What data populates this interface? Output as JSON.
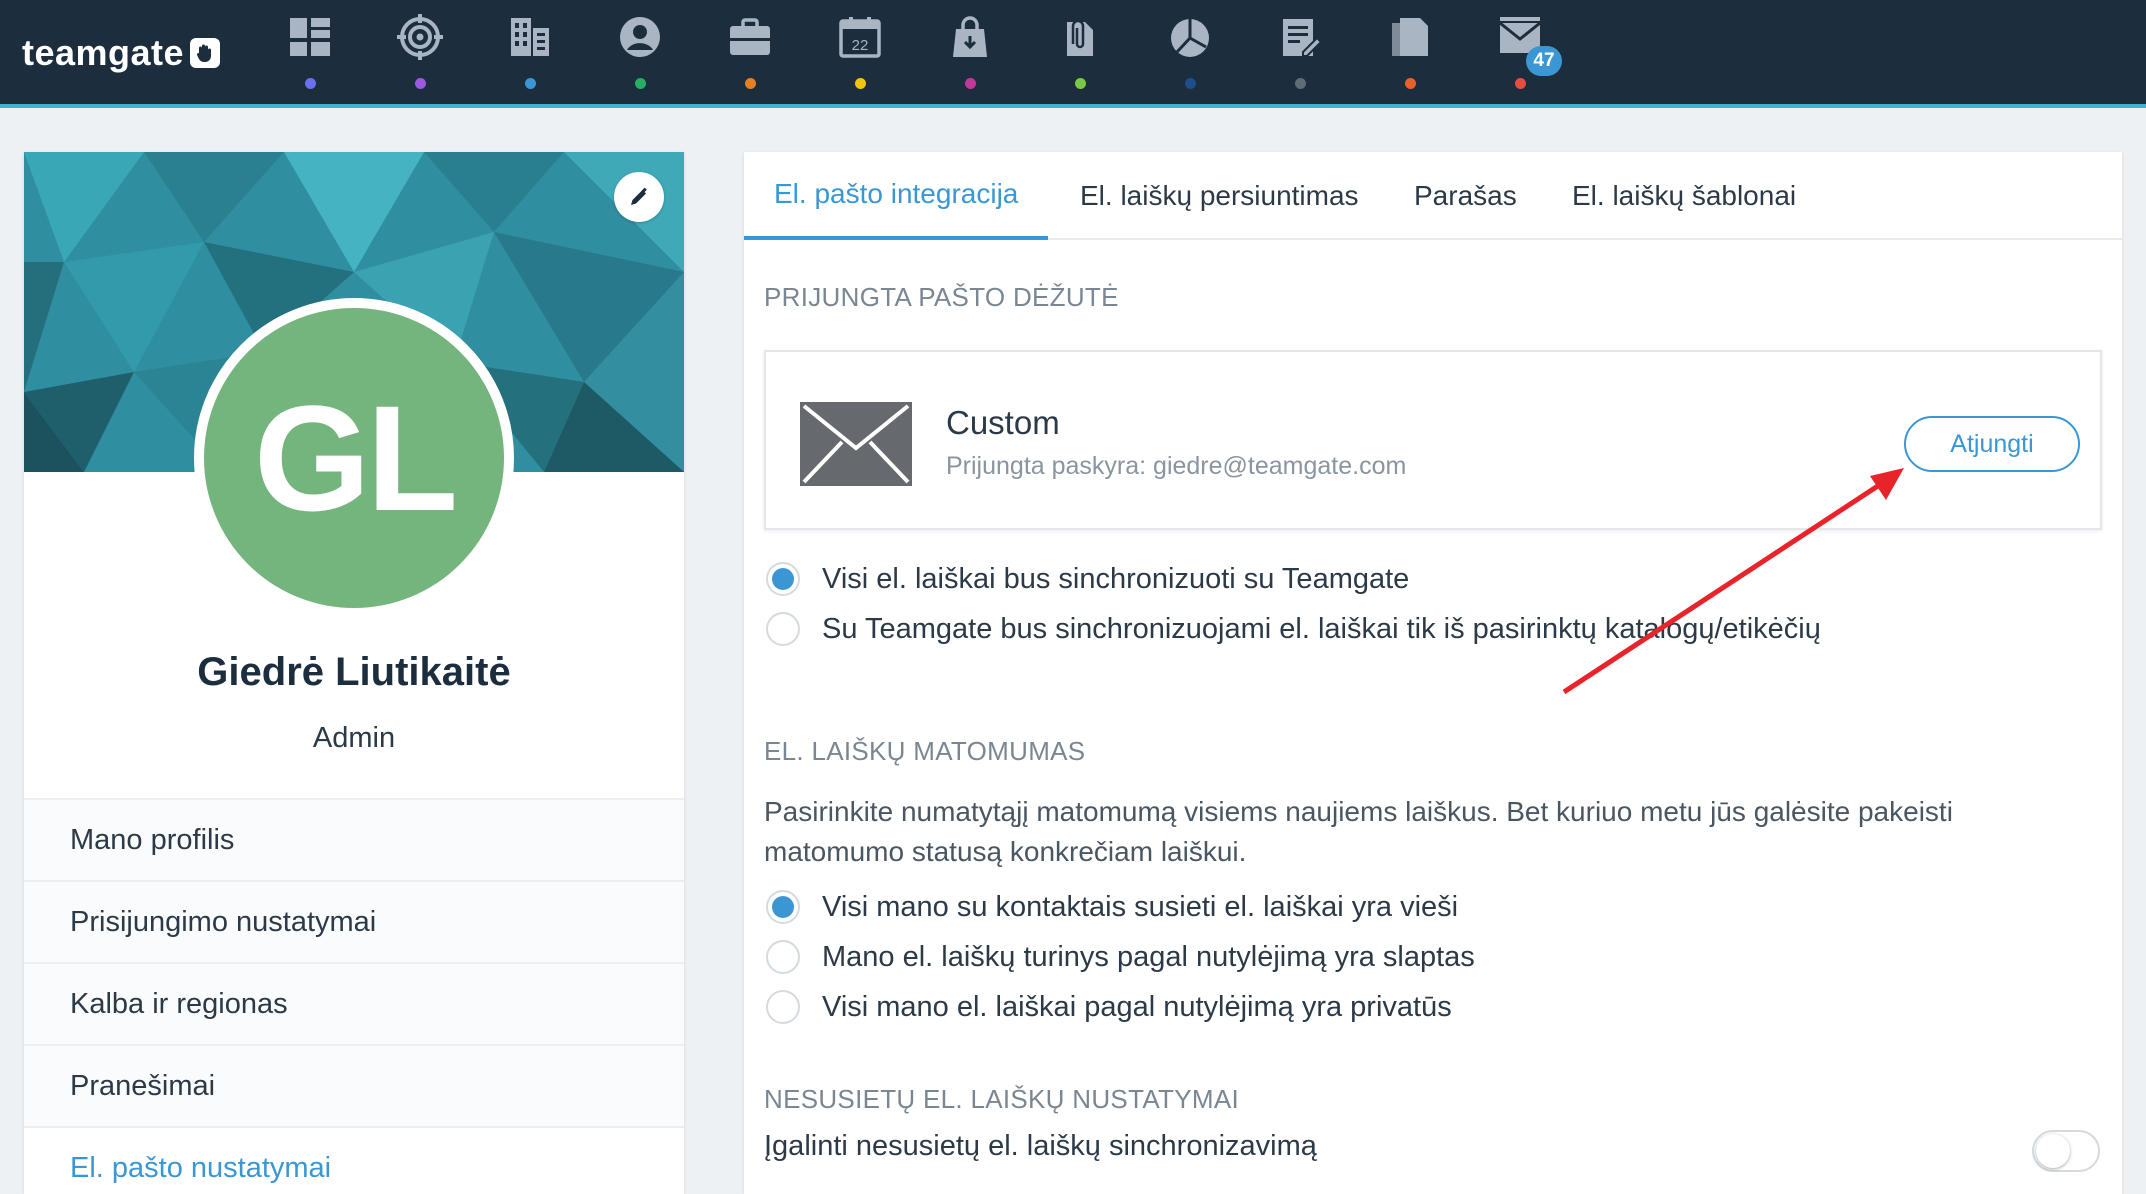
{
  "app": {
    "logo_text": "teamgate"
  },
  "nav": {
    "items": [
      {
        "icon": "dashboard-icon",
        "dot_color": "#6b6ff0"
      },
      {
        "icon": "target-icon",
        "dot_color": "#9b59e0"
      },
      {
        "icon": "companies-icon",
        "dot_color": "#3a97d4"
      },
      {
        "icon": "contacts-icon",
        "dot_color": "#27ae60"
      },
      {
        "icon": "deals-icon",
        "dot_color": "#e67e22"
      },
      {
        "icon": "calendar-icon",
        "dot_color": "#f1c40f",
        "calendar_day": "22"
      },
      {
        "icon": "sales-icon",
        "dot_color": "#c0399a"
      },
      {
        "icon": "attachments-icon",
        "dot_color": "#7ac943"
      },
      {
        "icon": "reports-icon",
        "dot_color": "#1f4e8c"
      },
      {
        "icon": "notes-icon",
        "dot_color": "#5f6b75"
      },
      {
        "icon": "documents-icon",
        "dot_color": "#e8612c"
      },
      {
        "icon": "mail-icon",
        "dot_color": "#e74c3c",
        "badge": "47"
      }
    ]
  },
  "profile": {
    "initials": "GL",
    "name": "Giedrė Liutikaitė",
    "role": "Admin",
    "avatar_color": "#74b57e",
    "menu": [
      {
        "label": "Mano profilis",
        "active": false
      },
      {
        "label": "Prisijungimo nustatymai",
        "active": false
      },
      {
        "label": "Kalba ir regionas",
        "active": false
      },
      {
        "label": "Pranešimai",
        "active": false
      },
      {
        "label": "El. pašto nustatymai",
        "active": true
      }
    ]
  },
  "tabs": [
    {
      "label": "El. pašto integracija",
      "active": true
    },
    {
      "label": "El. laiškų persiuntimas",
      "active": false
    },
    {
      "label": "Parašas",
      "active": false
    },
    {
      "label": "El. laiškų šablonai",
      "active": false
    }
  ],
  "connected": {
    "section_title": "PRIJUNGTA PAŠTO DĖŽUTĖ",
    "provider": "Custom",
    "account": "Prijungta paskyra: giedre@teamgate.com",
    "disconnect_label": "Atjungti"
  },
  "sync": {
    "options": [
      {
        "label": "Visi el. laiškai bus sinchronizuoti su Teamgate",
        "checked": true
      },
      {
        "label": "Su Teamgate bus sinchronizuojami el. laiškai tik iš pasirinktų katalogų/etikėčių",
        "checked": false
      }
    ]
  },
  "visibility": {
    "section_title": "EL. LAIŠKŲ MATOMUMAS",
    "description": "Pasirinkite numatytąjį matomumą visiems naujiems laiškus. Bet kuriuo metu jūs galėsite pakeisti matomumo statusą konkrečiam laiškui.",
    "options": [
      {
        "label": "Visi mano su kontaktais susieti el. laiškai yra vieši",
        "checked": true
      },
      {
        "label": "Mano el. laiškų turinys pagal nutylėjimą yra slaptas",
        "checked": false
      },
      {
        "label": "Visi mano el. laiškai pagal nutylėjimą yra privatūs",
        "checked": false
      }
    ]
  },
  "unlinked": {
    "section_title": "NESUSIETŲ EL. LAIŠKŲ NUSTATYMAI",
    "toggle_label": "Įgalinti nesusietų el. laiškų sinchronizavimą",
    "toggle_on": false
  },
  "colors": {
    "accent": "#3a97d4",
    "topbar": "#1c2d3e",
    "annotation_arrow": "#e8232a"
  }
}
